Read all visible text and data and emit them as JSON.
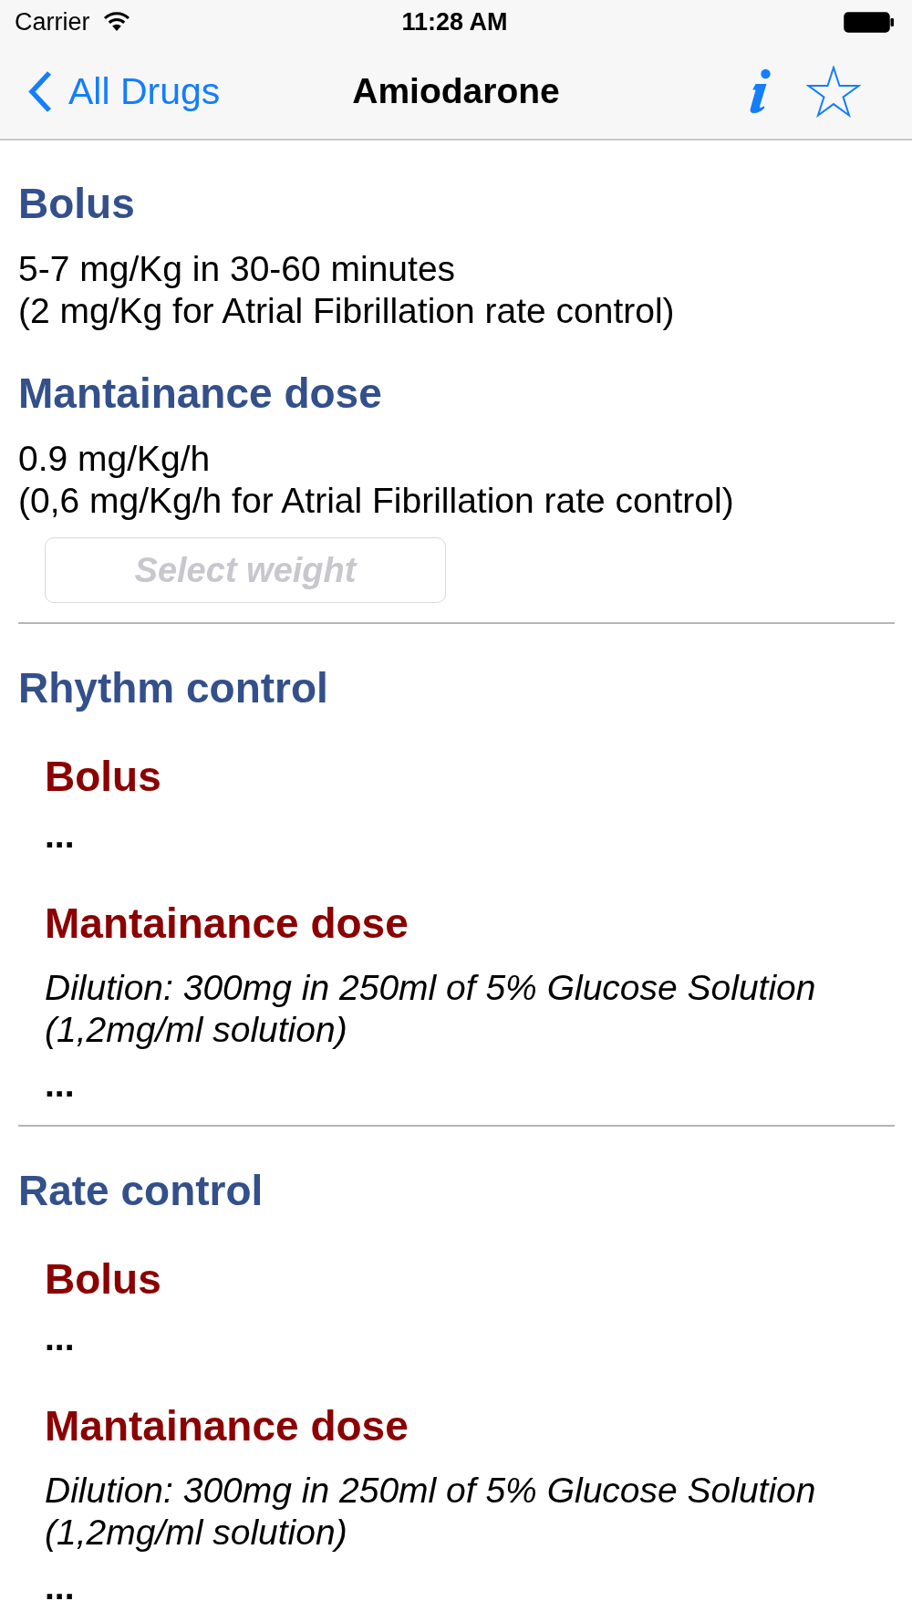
{
  "status_bar": {
    "carrier": "Carrier",
    "time": "11:28 AM"
  },
  "nav_bar": {
    "back_label": "All Drugs",
    "title": "Amiodarone",
    "favorite": false
  },
  "dosing": [
    {
      "heading": "Bolus",
      "lines": [
        "5-7 mg/Kg in 30-60 minutes",
        "(2 mg/Kg for Atrial Fibrillation rate control)"
      ]
    },
    {
      "heading": "Mantainance dose",
      "lines": [
        "0.9 mg/Kg/h",
        "(0,6 mg/Kg/h for Atrial Fibrillation rate control)"
      ]
    }
  ],
  "weight_field": {
    "placeholder": "Select weight"
  },
  "protocols": [
    {
      "heading": "Rhythm control",
      "items": [
        {
          "heading": "Bolus",
          "text": "..."
        },
        {
          "heading": "Mantainance dose",
          "dilution": [
            "Dilution: 300mg in 250ml of 5% Glucose Solution",
            "(1,2mg/ml solution)"
          ],
          "text": "..."
        }
      ]
    },
    {
      "heading": "Rate control",
      "items": [
        {
          "heading": "Bolus",
          "text": "..."
        },
        {
          "heading": "Mantainance dose",
          "dilution": [
            "Dilution: 300mg in 250ml of 5% Glucose Solution",
            "(1,2mg/ml solution)"
          ],
          "text": "..."
        }
      ]
    }
  ]
}
